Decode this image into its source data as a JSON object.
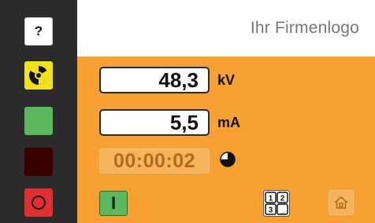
{
  "sidebar": {
    "help_label": "?",
    "colors": {
      "background": "#2b2b2b",
      "radiation": "#f2e21c",
      "green": "#5cb85c",
      "dark": "#3a0000",
      "stop": "#e12f2f"
    },
    "icons": [
      "help-icon",
      "radiation-icon",
      "status-green",
      "status-dark",
      "stop-icon"
    ]
  },
  "header": {
    "logo_text": "Ihr Firmenlogo"
  },
  "controls": {
    "kv_value": "48,3",
    "kv_unit": "kV",
    "ma_value": "5,5",
    "ma_unit": "mA",
    "timer_value": "00:00:02",
    "timer_progress": 0.75,
    "start_label": "I",
    "keypad_digits": [
      "1",
      "2",
      "3",
      "_"
    ],
    "icons": [
      "clock-pie-icon",
      "keypad-icon",
      "home-icon"
    ]
  },
  "theme": {
    "panel": "#f6a132",
    "disabled_field": "#f6b45a"
  }
}
